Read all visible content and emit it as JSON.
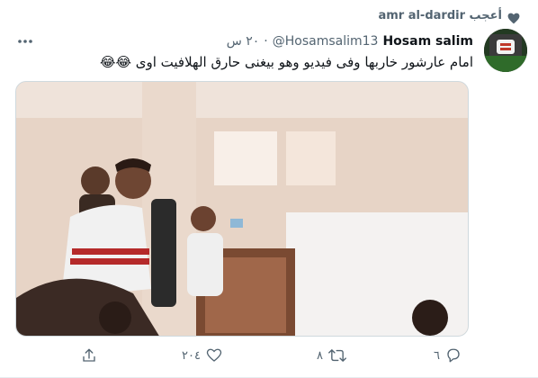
{
  "social_context": {
    "text": "amr al-dardir أعجب",
    "icon": "heart-icon"
  },
  "tweet": {
    "display_name": "Hosam salim",
    "handle": "@Hosamsalim13",
    "separator": "·",
    "time": "٢٠ س",
    "text": "امام عارشور خاربها وفى فيديو وهو بيغنى حارق الهلافيت اوى 😂😂",
    "counts": {
      "reply": "٦",
      "retweet": "٨",
      "like": "٢٠٤"
    }
  },
  "colors": {
    "text": "#0f1419",
    "secondary": "#536471",
    "border": "#cfd9de"
  }
}
